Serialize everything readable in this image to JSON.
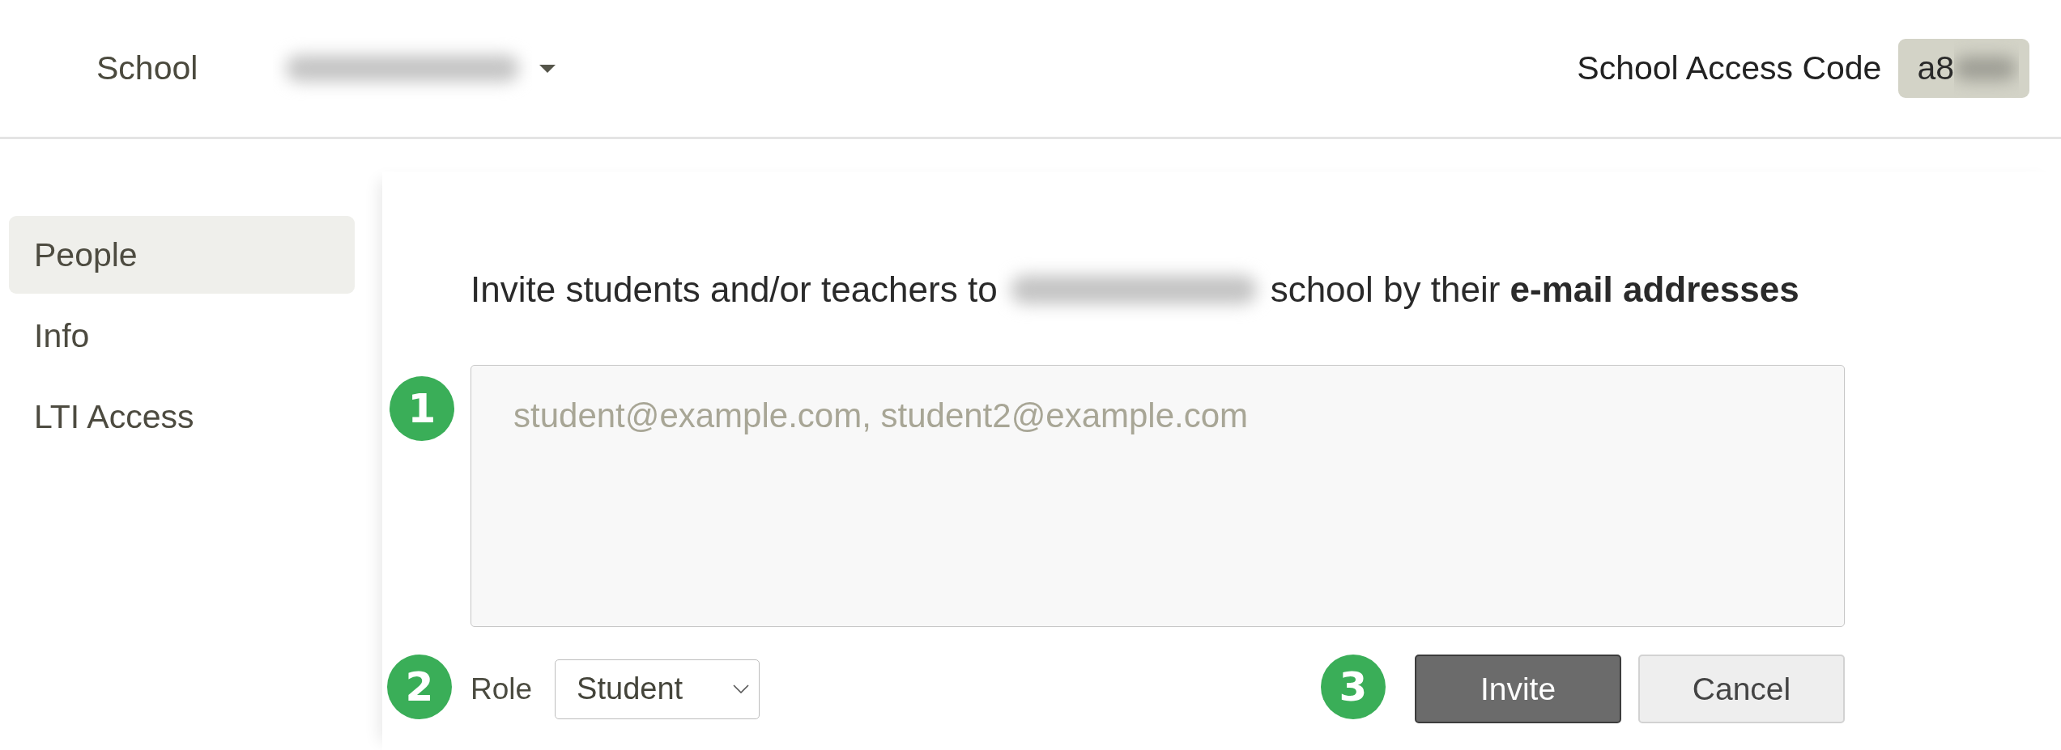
{
  "header": {
    "title": "School",
    "school_name_redacted": true,
    "access_code": {
      "label": "School Access Code",
      "value": "a8",
      "rest_redacted": true
    }
  },
  "sidebar": {
    "items": [
      {
        "label": "People",
        "selected": true
      },
      {
        "label": "Info",
        "selected": false
      },
      {
        "label": "LTI Access",
        "selected": false
      }
    ]
  },
  "invite": {
    "text_before": "Invite students and/or teachers to",
    "school_name_redacted": true,
    "text_after": "school by their **e-mail addresses**"
  },
  "emails": {
    "step": "1",
    "placeholder": "student@example.com, student2@example.com"
  },
  "role": {
    "step": "2",
    "label": "Role",
    "value": "Student"
  },
  "actions": {
    "step": "3",
    "buttons": [
      {
        "label": "Invite",
        "kind": "primary"
      },
      {
        "label": "Cancel",
        "kind": "secondary"
      }
    ]
  }
}
